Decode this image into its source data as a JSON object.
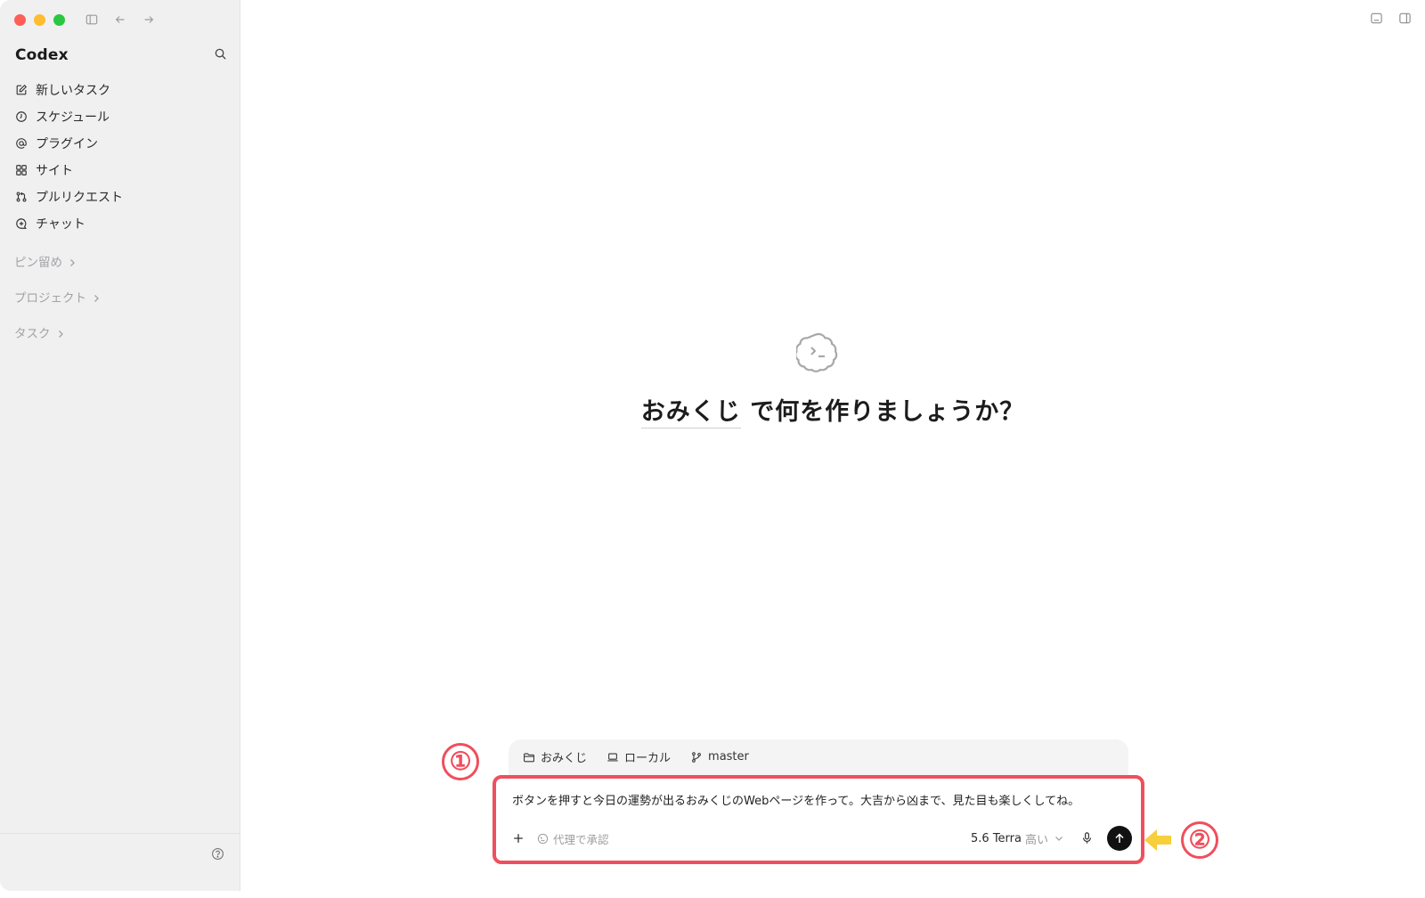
{
  "app": {
    "name": "Codex"
  },
  "sidebar": {
    "items": [
      {
        "label": "新しいタスク",
        "icon": "edit-icon"
      },
      {
        "label": "スケジュール",
        "icon": "clock-icon"
      },
      {
        "label": "プラグイン",
        "icon": "at-sign-icon"
      },
      {
        "label": "サイト",
        "icon": "grid-icon"
      },
      {
        "label": "プルリクエスト",
        "icon": "pull-request-icon"
      },
      {
        "label": "チャット",
        "icon": "chat-plus-icon"
      }
    ],
    "sections": [
      {
        "label": "ピン留め"
      },
      {
        "label": "プロジェクト"
      },
      {
        "label": "タスク"
      }
    ]
  },
  "hero": {
    "project": "おみくじ",
    "question": " で何を作りましょうか？"
  },
  "composer": {
    "context": {
      "folder": "おみくじ",
      "environment": "ローカル",
      "branch": "master"
    },
    "prompt": "ボタンを押すと今日の運勢が出るおみくじのWebページを作って。大吉から凶まで、見た目も楽しくしてね。",
    "approval": "代理で承認",
    "model": "5.6 Terra",
    "effort": "高い"
  },
  "annotations": {
    "step1": "①",
    "step2": "②"
  },
  "colors": {
    "sidebar_bg": "#f0f0f1",
    "highlight": "#ef4f5e",
    "arrow": "#f7cf3c",
    "send_button": "#111111"
  }
}
